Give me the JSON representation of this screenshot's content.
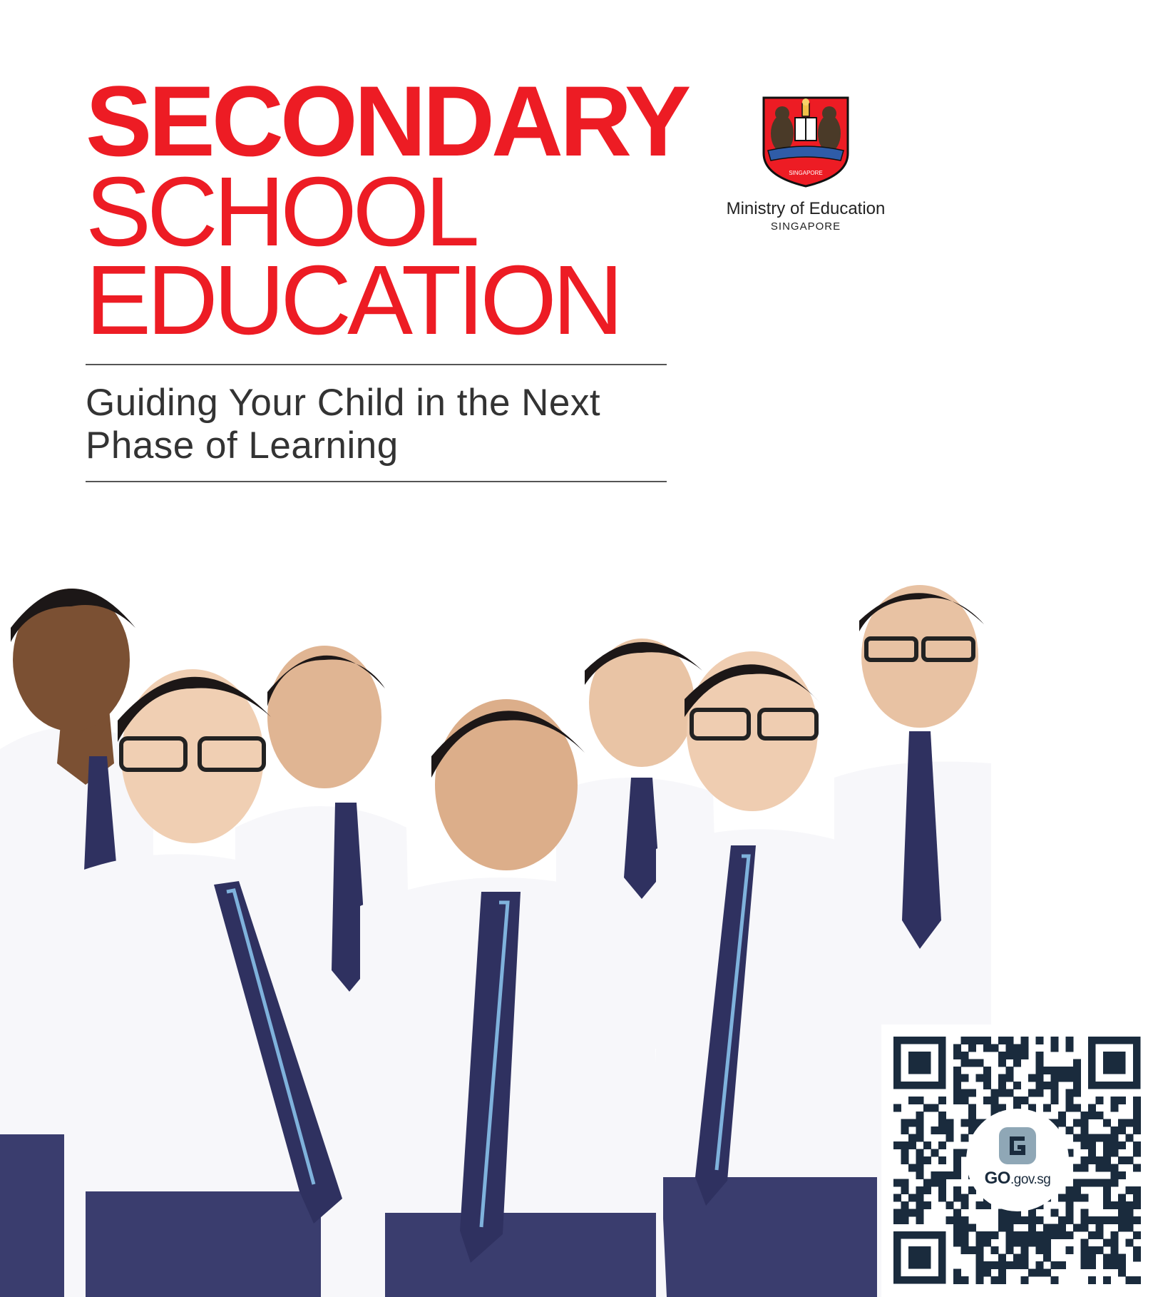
{
  "cover": {
    "title_line1": "SECONDARY",
    "title_line2": "SCHOOL",
    "title_line3": "EDUCATION",
    "subtitle_line1": "Guiding Your Child in the Next",
    "subtitle_line2": "Phase of Learning"
  },
  "publisher": {
    "name": "Ministry of Education",
    "country": "SINGAPORE",
    "crest_banner": "SINGAPORE"
  },
  "qr": {
    "brand_main": "GO",
    "brand_suffix": ".gov.sg"
  },
  "colors": {
    "title_red": "#ED1C24",
    "uniform_navy": "#3a3d6e",
    "tie_stripe": "#7fb2dc",
    "qr_dark": "#1a2b3d"
  }
}
